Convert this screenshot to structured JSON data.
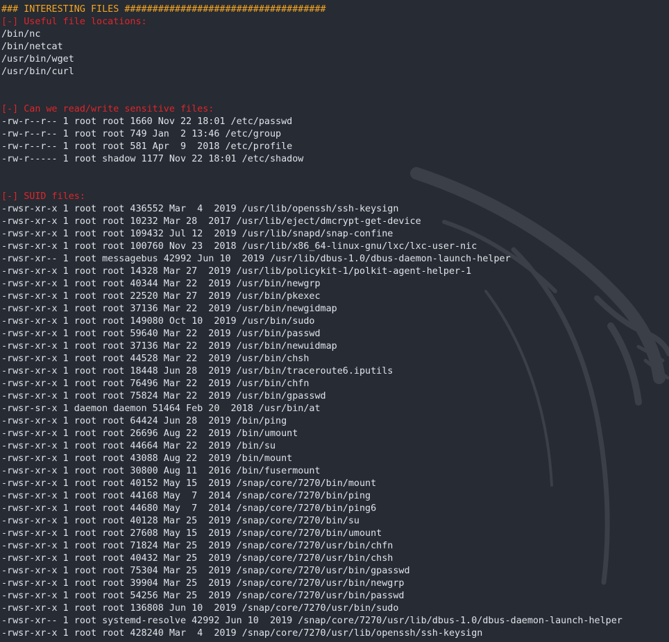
{
  "terminal": {
    "colors": {
      "background": "#272b33",
      "foreground": "#dfe3ea",
      "header": "#f5a623",
      "section": "#e0252b"
    },
    "background_logo": "kali-dragon-icon",
    "lines": [
      {
        "kind": "hdr",
        "text": "### INTERESTING FILES ####################################"
      },
      {
        "kind": "sec",
        "text": "[-] Useful file locations:"
      },
      {
        "kind": "txt",
        "text": "/bin/nc"
      },
      {
        "kind": "txt",
        "text": "/bin/netcat"
      },
      {
        "kind": "txt",
        "text": "/usr/bin/wget"
      },
      {
        "kind": "txt",
        "text": "/usr/bin/curl"
      },
      {
        "kind": "blank",
        "text": ""
      },
      {
        "kind": "blank",
        "text": ""
      },
      {
        "kind": "sec",
        "text": "[-] Can we read/write sensitive files:"
      },
      {
        "kind": "txt",
        "text": "-rw-r--r-- 1 root root 1660 Nov 22 18:01 /etc/passwd"
      },
      {
        "kind": "txt",
        "text": "-rw-r--r-- 1 root root 749 Jan  2 13:46 /etc/group"
      },
      {
        "kind": "txt",
        "text": "-rw-r--r-- 1 root root 581 Apr  9  2018 /etc/profile"
      },
      {
        "kind": "txt",
        "text": "-rw-r----- 1 root shadow 1177 Nov 22 18:01 /etc/shadow"
      },
      {
        "kind": "blank",
        "text": ""
      },
      {
        "kind": "blank",
        "text": ""
      },
      {
        "kind": "sec",
        "text": "[-] SUID files:"
      },
      {
        "kind": "txt",
        "text": "-rwsr-xr-x 1 root root 436552 Mar  4  2019 /usr/lib/openssh/ssh-keysign"
      },
      {
        "kind": "txt",
        "text": "-rwsr-xr-x 1 root root 10232 Mar 28  2017 /usr/lib/eject/dmcrypt-get-device"
      },
      {
        "kind": "txt",
        "text": "-rwsr-xr-x 1 root root 109432 Jul 12  2019 /usr/lib/snapd/snap-confine"
      },
      {
        "kind": "txt",
        "text": "-rwsr-xr-x 1 root root 100760 Nov 23  2018 /usr/lib/x86_64-linux-gnu/lxc/lxc-user-nic"
      },
      {
        "kind": "txt",
        "text": "-rwsr-xr-- 1 root messagebus 42992 Jun 10  2019 /usr/lib/dbus-1.0/dbus-daemon-launch-helper"
      },
      {
        "kind": "txt",
        "text": "-rwsr-xr-x 1 root root 14328 Mar 27  2019 /usr/lib/policykit-1/polkit-agent-helper-1"
      },
      {
        "kind": "txt",
        "text": "-rwsr-xr-x 1 root root 40344 Mar 22  2019 /usr/bin/newgrp"
      },
      {
        "kind": "txt",
        "text": "-rwsr-xr-x 1 root root 22520 Mar 27  2019 /usr/bin/pkexec"
      },
      {
        "kind": "txt",
        "text": "-rwsr-xr-x 1 root root 37136 Mar 22  2019 /usr/bin/newgidmap"
      },
      {
        "kind": "txt",
        "text": "-rwsr-xr-x 1 root root 149080 Oct 10  2019 /usr/bin/sudo"
      },
      {
        "kind": "txt",
        "text": "-rwsr-xr-x 1 root root 59640 Mar 22  2019 /usr/bin/passwd"
      },
      {
        "kind": "txt",
        "text": "-rwsr-xr-x 1 root root 37136 Mar 22  2019 /usr/bin/newuidmap"
      },
      {
        "kind": "txt",
        "text": "-rwsr-xr-x 1 root root 44528 Mar 22  2019 /usr/bin/chsh"
      },
      {
        "kind": "txt",
        "text": "-rwsr-xr-x 1 root root 18448 Jun 28  2019 /usr/bin/traceroute6.iputils"
      },
      {
        "kind": "txt",
        "text": "-rwsr-xr-x 1 root root 76496 Mar 22  2019 /usr/bin/chfn"
      },
      {
        "kind": "txt",
        "text": "-rwsr-xr-x 1 root root 75824 Mar 22  2019 /usr/bin/gpasswd"
      },
      {
        "kind": "txt",
        "text": "-rwsr-sr-x 1 daemon daemon 51464 Feb 20  2018 /usr/bin/at"
      },
      {
        "kind": "txt",
        "text": "-rwsr-xr-x 1 root root 64424 Jun 28  2019 /bin/ping"
      },
      {
        "kind": "txt",
        "text": "-rwsr-xr-x 1 root root 26696 Aug 22  2019 /bin/umount"
      },
      {
        "kind": "txt",
        "text": "-rwsr-xr-x 1 root root 44664 Mar 22  2019 /bin/su"
      },
      {
        "kind": "txt",
        "text": "-rwsr-xr-x 1 root root 43088 Aug 22  2019 /bin/mount"
      },
      {
        "kind": "txt",
        "text": "-rwsr-xr-x 1 root root 30800 Aug 11  2016 /bin/fusermount"
      },
      {
        "kind": "txt",
        "text": "-rwsr-xr-x 1 root root 40152 May 15  2019 /snap/core/7270/bin/mount"
      },
      {
        "kind": "txt",
        "text": "-rwsr-xr-x 1 root root 44168 May  7  2014 /snap/core/7270/bin/ping"
      },
      {
        "kind": "txt",
        "text": "-rwsr-xr-x 1 root root 44680 May  7  2014 /snap/core/7270/bin/ping6"
      },
      {
        "kind": "txt",
        "text": "-rwsr-xr-x 1 root root 40128 Mar 25  2019 /snap/core/7270/bin/su"
      },
      {
        "kind": "txt",
        "text": "-rwsr-xr-x 1 root root 27608 May 15  2019 /snap/core/7270/bin/umount"
      },
      {
        "kind": "txt",
        "text": "-rwsr-xr-x 1 root root 71824 Mar 25  2019 /snap/core/7270/usr/bin/chfn"
      },
      {
        "kind": "txt",
        "text": "-rwsr-xr-x 1 root root 40432 Mar 25  2019 /snap/core/7270/usr/bin/chsh"
      },
      {
        "kind": "txt",
        "text": "-rwsr-xr-x 1 root root 75304 Mar 25  2019 /snap/core/7270/usr/bin/gpasswd"
      },
      {
        "kind": "txt",
        "text": "-rwsr-xr-x 1 root root 39904 Mar 25  2019 /snap/core/7270/usr/bin/newgrp"
      },
      {
        "kind": "txt",
        "text": "-rwsr-xr-x 1 root root 54256 Mar 25  2019 /snap/core/7270/usr/bin/passwd"
      },
      {
        "kind": "txt",
        "text": "-rwsr-xr-x 1 root root 136808 Jun 10  2019 /snap/core/7270/usr/bin/sudo"
      },
      {
        "kind": "txt",
        "text": "-rwsr-xr-- 1 root systemd-resolve 42992 Jun 10  2019 /snap/core/7270/usr/lib/dbus-1.0/dbus-daemon-launch-helper"
      },
      {
        "kind": "txt",
        "text": "-rwsr-xr-x 1 root root 428240 Mar  4  2019 /snap/core/7270/usr/lib/openssh/ssh-keysign"
      }
    ]
  }
}
